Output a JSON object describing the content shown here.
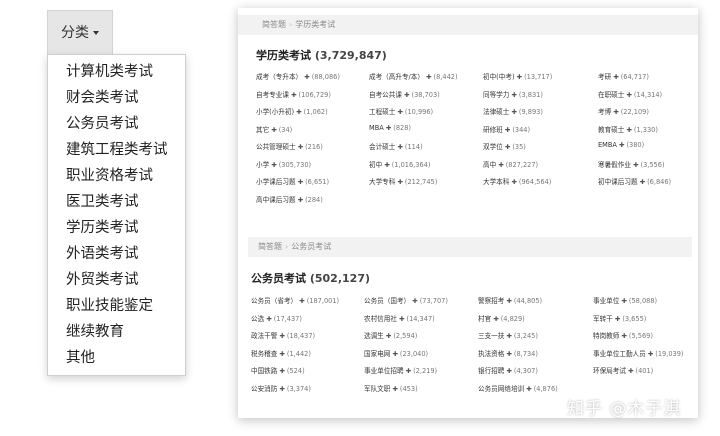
{
  "dropdown": {
    "label": "分类",
    "items": [
      "计算机类考试",
      "财会类考试",
      "公务员考试",
      "建筑工程类考试",
      "职业资格考试",
      "医卫类考试",
      "学历类考试",
      "外语类考试",
      "外贸类考试",
      "职业技能鉴定",
      "继续教育",
      "其他"
    ]
  },
  "section1": {
    "breadcrumb": [
      "简答题",
      "学历类考试"
    ],
    "title": "学历类考试",
    "count": "(3,729,847)",
    "rows": [
      [
        [
          "成考（专升本）",
          "(88,086)"
        ],
        [
          "成考（高升专/本）",
          "(8,442)"
        ],
        [
          "初中(中考)",
          "(13,717)"
        ],
        [
          "考研",
          "(64,717)"
        ]
      ],
      [
        [
          "自考专业课",
          "(106,729)"
        ],
        [
          "自考公共课",
          "(38,703)"
        ],
        [
          "同等学力",
          "(3,831)"
        ],
        [
          "在职硕士",
          "(14,314)"
        ]
      ],
      [
        [
          "小学(小升初)",
          "(1,062)"
        ],
        [
          "工程硕士",
          "(10,996)"
        ],
        [
          "法律硕士",
          "(9,893)"
        ],
        [
          "考博",
          "(22,109)"
        ]
      ],
      [
        [
          "其它",
          "(34)"
        ],
        [
          "MBA",
          "(828)"
        ],
        [
          "研修班",
          "(344)"
        ],
        [
          "教育硕士",
          "(1,330)"
        ]
      ],
      [
        [
          "公共管理硕士",
          "(216)"
        ],
        [
          "会计硕士",
          "(114)"
        ],
        [
          "双学位",
          "(35)"
        ],
        [
          "EMBA",
          "(380)"
        ]
      ],
      [
        [
          "小学",
          "(305,730)"
        ],
        [
          "初中",
          "(1,016,364)"
        ],
        [
          "高中",
          "(827,227)"
        ],
        [
          "寒暑假作业",
          "(3,556)"
        ]
      ],
      [
        [
          "小学课后习题",
          "(6,651)"
        ],
        [
          "大学专科",
          "(212,745)"
        ],
        [
          "大学本科",
          "(964,564)"
        ],
        [
          "初中课后习题",
          "(6,846)"
        ]
      ],
      [
        [
          "高中课后习题",
          "(284)"
        ]
      ]
    ]
  },
  "section2": {
    "breadcrumb": [
      "简答题",
      "公务员考试"
    ],
    "title": "公务员考试",
    "count": "(502,127)",
    "rows": [
      [
        [
          "公务员（省考）",
          "(187,001)"
        ],
        [
          "公务员（国考）",
          "(73,707)"
        ],
        [
          "警察招考",
          "(44,805)"
        ],
        [
          "事业单位",
          "(58,088)"
        ]
      ],
      [
        [
          "公选",
          "(17,437)"
        ],
        [
          "农村信用社",
          "(14,347)"
        ],
        [
          "村官",
          "(4,829)"
        ],
        [
          "军转干",
          "(3,655)"
        ]
      ],
      [
        [
          "政法干警",
          "(18,437)"
        ],
        [
          "选调生",
          "(2,594)"
        ],
        [
          "三支一扶",
          "(3,245)"
        ],
        [
          "特岗教师",
          "(5,569)"
        ]
      ],
      [
        [
          "税务稽查",
          "(1,442)"
        ],
        [
          "国家电网",
          "(23,040)"
        ],
        [
          "执法资格",
          "(8,734)"
        ],
        [
          "事业单位工勤人员",
          "(19,039)"
        ]
      ],
      [
        [
          "中国铁路",
          "(524)"
        ],
        [
          "事业单位招聘",
          "(2,219)"
        ],
        [
          "银行招聘",
          "(4,307)"
        ],
        [
          "环保局考试",
          "(401)"
        ]
      ],
      [
        [
          "公安消防",
          "(3,374)"
        ],
        [
          "军队文职",
          "(453)"
        ],
        [
          "公务员网络培训",
          "(4,876)"
        ]
      ]
    ]
  },
  "watermark": "知乎 @木子淇",
  "plus_symbol": "✚"
}
